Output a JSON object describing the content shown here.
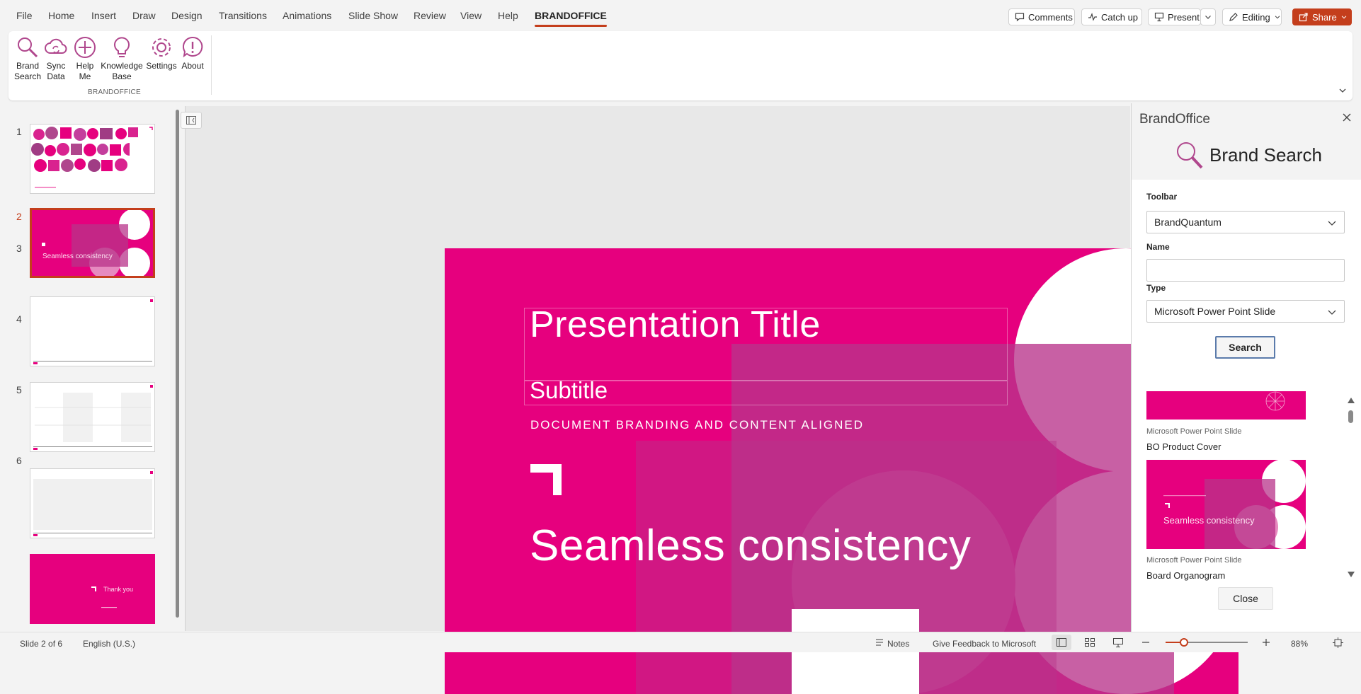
{
  "menu": {
    "tabs": [
      "File",
      "Home",
      "Insert",
      "Draw",
      "Design",
      "Transitions",
      "Animations",
      "Slide Show",
      "Review",
      "View",
      "Help",
      "BRANDOFFICE"
    ],
    "comments": "Comments",
    "catch_up": "Catch up",
    "present": "Present",
    "editing": "Editing",
    "share": "Share"
  },
  "ribbon": {
    "buttons": [
      {
        "line1": "Brand",
        "line2": "Search",
        "icon": "magnifier-icon"
      },
      {
        "line1": "Sync",
        "line2": "Data",
        "icon": "cloud-sync-icon"
      },
      {
        "line1": "Help",
        "line2": "Me",
        "icon": "plus-circle-icon"
      },
      {
        "line1": "Knowledge",
        "line2": "Base",
        "icon": "lightbulb-icon"
      },
      {
        "line1": "Settings",
        "line2": "",
        "icon": "gear-icon"
      },
      {
        "line1": "About",
        "line2": "",
        "icon": "exclamation-bubble-icon"
      }
    ],
    "group_label": "BRANDOFFICE"
  },
  "thumbnails": {
    "numbers": [
      "1",
      "2",
      "3",
      "4",
      "5",
      "6"
    ],
    "selected": 2,
    "slide6_text": "Thank you",
    "slide2_text": "Seamless consistency"
  },
  "slide": {
    "title": "Presentation Title",
    "subtitle": "Subtitle",
    "tagline": "DOCUMENT BRANDING AND CONTENT ALIGNED",
    "headline": "Seamless consistency",
    "accent": "#e6007e"
  },
  "pane": {
    "title": "BrandOffice",
    "heading": "Brand Search",
    "toolbar_label": "Toolbar",
    "toolbar_value": "BrandQuantum",
    "name_label": "Name",
    "name_value": "",
    "type_label": "Type",
    "type_value": "Microsoft Power Point Slide",
    "search_button": "Search",
    "results": [
      {
        "type": "Microsoft Power Point Slide",
        "title": "BO Product Cover"
      },
      {
        "type": "Microsoft Power Point Slide",
        "title": "Board Organogram"
      }
    ],
    "result2_text": "Seamless consistency",
    "close_button": "Close"
  },
  "status": {
    "slide_info": "Slide 2 of 6",
    "language": "English (U.S.)",
    "notes": "Notes",
    "feedback": "Give Feedback to Microsoft",
    "zoom": "88%"
  }
}
